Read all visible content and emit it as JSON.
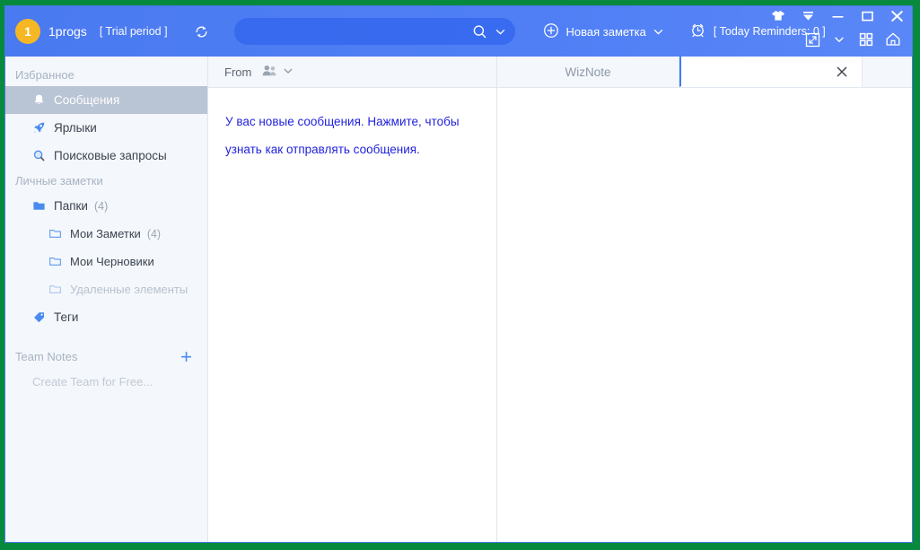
{
  "window": {
    "recording_border_color": "#078A3E",
    "border_color": "#4a79e8"
  },
  "toolbar": {
    "avatar_initial": "1",
    "username": "1progs",
    "trial_label": "[ Trial period ]",
    "sync_icon": "sync-icon",
    "search": {
      "value": "",
      "placeholder": "",
      "search_icon": "search-icon",
      "dropdown_icon": "chevron-down-icon"
    },
    "new_note": {
      "label": "Новая заметка",
      "icon": "plus-circle-icon",
      "dropdown_icon": "chevron-down-icon"
    },
    "reminders": {
      "label": "[ Today Reminders: 0 ]",
      "icon": "alarm-clock-icon"
    },
    "right_icons": [
      {
        "name": "fullscreen-icon",
        "label": "Fullscreen"
      },
      {
        "name": "chevron-down-icon",
        "label": "More"
      },
      {
        "name": "grid-view-icon",
        "label": "Grid view"
      },
      {
        "name": "home-icon",
        "label": "Home"
      }
    ],
    "window_controls": [
      {
        "name": "skin-tshirt-icon",
        "label": "Skin"
      },
      {
        "name": "collapse-arrow-icon",
        "label": "Collapse"
      },
      {
        "name": "minimize-button",
        "label": "Minimize"
      },
      {
        "name": "maximize-button",
        "label": "Maximize"
      },
      {
        "name": "close-button",
        "label": "Close"
      }
    ],
    "accent_color": "#4a7af0",
    "avatar_color": "#f5b723"
  },
  "sidebar": {
    "favorites_header": "Избранное",
    "favorites": [
      {
        "label": "Сообщения",
        "icon": "bell-icon",
        "selected": true,
        "count": ""
      },
      {
        "label": "Ярлыки",
        "icon": "rocket-icon",
        "selected": false,
        "count": ""
      },
      {
        "label": "Поисковые запросы",
        "icon": "magnifier-icon",
        "selected": false,
        "count": ""
      }
    ],
    "personal_header": "Личные заметки",
    "personal": [
      {
        "label": "Папки",
        "icon": "folder-filled-icon",
        "count": "(4)",
        "indent": false,
        "muted": false
      },
      {
        "label": "Мои Заметки",
        "icon": "folder-outline-icon",
        "count": "(4)",
        "indent": true,
        "muted": false
      },
      {
        "label": "Мои Черновики",
        "icon": "folder-outline-icon",
        "count": "",
        "indent": true,
        "muted": false
      },
      {
        "label": "Удаленные элементы",
        "icon": "folder-outline-icon",
        "count": "",
        "indent": true,
        "muted": true
      },
      {
        "label": "Теги",
        "icon": "tag-icon",
        "count": "",
        "indent": false,
        "muted": false
      }
    ],
    "team_header": "Team Notes",
    "team_add_icon": "plus-icon",
    "team_empty_label": "Create Team for Free...",
    "selected_bg": "#b9c4d4"
  },
  "message_list": {
    "header_label": "From",
    "header_filter_icon": "people-icon",
    "header_dropdown_icon": "chevron-down-icon",
    "messages": [
      {
        "text": "У вас новые сообщения. Нажмите, чтобы узнать как отправлять сообщения.",
        "color": "#2222dd"
      }
    ]
  },
  "tabs": {
    "items": [
      {
        "label": "WizNote",
        "active": false,
        "closable": false
      },
      {
        "label": "",
        "active": true,
        "closable": true,
        "close_icon": "close-icon"
      }
    ]
  },
  "editor": {
    "content": ""
  }
}
